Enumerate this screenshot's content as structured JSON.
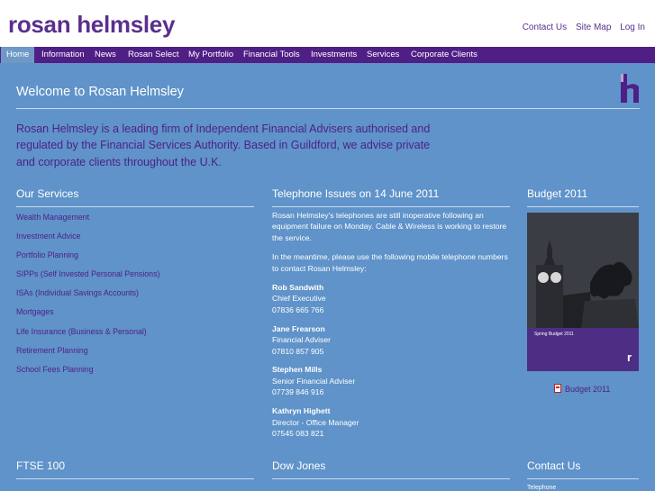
{
  "header": {
    "logo": "rosan helmsley",
    "links": [
      "Contact Us",
      "Site Map",
      "Log In"
    ]
  },
  "nav": {
    "items": [
      "Home",
      "Information",
      "News",
      "Rosan Select",
      "My Portfolio",
      "Financial Tools",
      "Investments",
      "Services",
      "Corporate Clients"
    ],
    "active_index": 0
  },
  "main": {
    "welcome_title": "Welcome to Rosan Helmsley",
    "intro": "Rosan Helmsley is a leading firm of Independent Financial Advisers authorised and regulated by the Financial Services Authority. Based in Guildford, we advise private and corporate clients throughout the U.K."
  },
  "services": {
    "title": "Our Services",
    "items": [
      "Wealth Management",
      "Investment Advice",
      "Portfolio Planning",
      "SIPPs (Self Invested Personal Pensions)",
      "ISAs (Individual Savings Accounts)",
      "Mortgages",
      "Life Insurance (Business & Personal)",
      "Retirement Planning",
      "School Fees Planning"
    ]
  },
  "telephone": {
    "title": "Telephone Issues on 14 June 2011",
    "para1": "Rosan Helmsley's telephones are still inoperative following an equipment failure on Monday. Cable & Wireless is working to restore the service.",
    "para2": "In the meantime, please use the following mobile telephone numbers to contact Rosan Helmsley:",
    "contacts": [
      {
        "name": "Rob Sandwith",
        "role": "Chief Executive",
        "phone": "07836 665 766"
      },
      {
        "name": "Jane Frearson",
        "role": "Financial Adviser",
        "phone": "07810 857 905"
      },
      {
        "name": "Stephen Mills",
        "role": "Senior Financial Adviser",
        "phone": "07739 846 916"
      },
      {
        "name": "Kathryn Highett",
        "role": "Director - Office Manager",
        "phone": "07545 083 821"
      }
    ]
  },
  "budget": {
    "title": "Budget 2011",
    "cover_text": "Spring Budget 2011",
    "link": "Budget 2011"
  },
  "bottom": {
    "ftse": "FTSE 100",
    "dow": "Dow Jones",
    "contact": "Contact Us",
    "contact_sub": "Telephone"
  },
  "colors": {
    "brand_purple": "#4f1f86",
    "background_blue": "#5f93c9"
  }
}
